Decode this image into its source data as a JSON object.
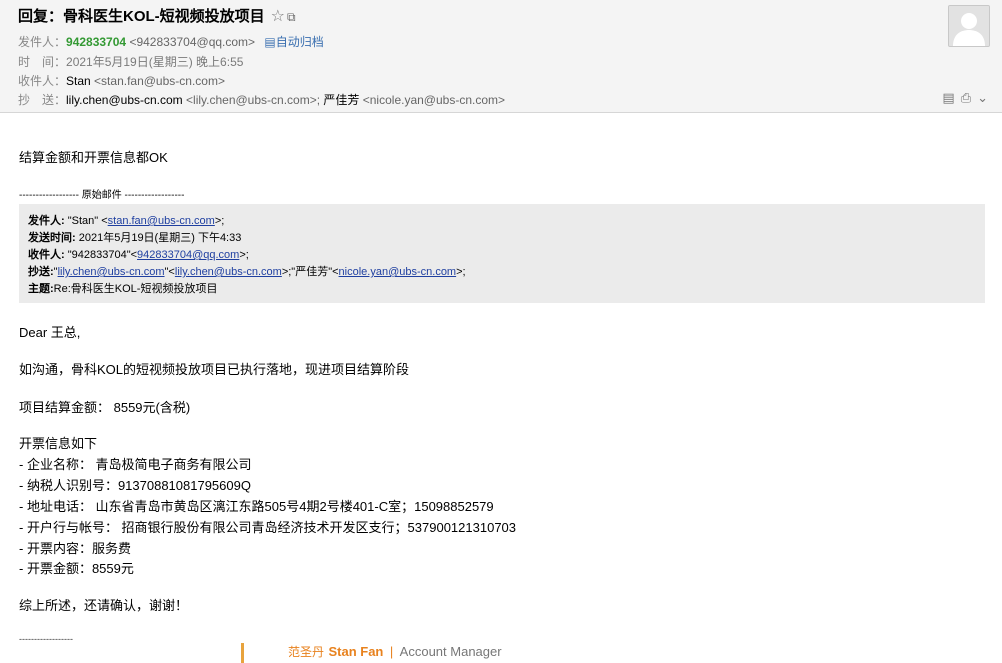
{
  "header": {
    "subject": "回复：骨科医生KOL-短视频投放项目",
    "star_glyph": "☆",
    "popout_glyph": "⧉",
    "from_label": "发件人：",
    "from_name": "942833704",
    "from_email": "<942833704@qq.com>",
    "auto_archive": "自动归档",
    "time_label": "时　间：",
    "time_value": "2021年5月19日(星期三) 晚上6:55",
    "to_label": "收件人：",
    "to_name": "Stan",
    "to_email": "<stan.fan@ubs-cn.com>",
    "cc_label": "抄　送：",
    "cc_name1": "lily.chen@ubs-cn.com",
    "cc_email1": "<lily.chen@ubs-cn.com>;",
    "cc_name2": "严佳芳",
    "cc_email2": "<nicole.yan@ubs-cn.com>"
  },
  "body": {
    "reply_line": "结算金额和开票信息都OK",
    "original_divider": "------------------ 原始邮件 ------------------",
    "quote": {
      "from_label": "发件人:",
      "from_value_pre": "\"Stan\" <",
      "from_link": "stan.fan@ubs-cn.com",
      "from_value_post": ">;",
      "sent_label": "发送时间:",
      "sent_value": "2021年5月19日(星期三) 下午4:33",
      "to_label": "收件人:",
      "to_value_pre": "\"942833704\"<",
      "to_link": "942833704@qq.com",
      "to_value_post": ">;",
      "cc_label": "抄送:",
      "cc_pre": "\"",
      "cc_link1": "lily.chen@ubs-cn.com",
      "cc_mid1": "\"<",
      "cc_link2": "lily.chen@ubs-cn.com",
      "cc_mid2": ">;\"严佳芳\"<",
      "cc_link3": "nicole.yan@ubs-cn.com",
      "cc_post": ">;",
      "subject_label": "主题:",
      "subject_value": "Re:骨科医生KOL-短视频投放项目"
    },
    "greeting": "Dear 王总,",
    "line1": "如沟通，骨科KOL的短视频投放项目已执行落地，现进项目结算阶段",
    "line2": "项目结算金额：  8559元(含税)",
    "invoice_title": "开票信息如下",
    "invoice_items": [
      "- 企业名称：  青岛极简电子商务有限公司",
      "- 纳税人识别号：91370881081795609Q",
      "- 地址电话：  山东省青岛市黄岛区漓江东路505号4期2号楼401-C室；15098852579",
      "- 开户行与帐号：  招商银行股份有限公司青岛经济技术开发区支行；537900121310703",
      "- 开票内容：服务费",
      "- 开票金额：8559元"
    ],
    "closing": "综上所述，还请确认，谢谢！",
    "sig_dash": "------------------",
    "signature": {
      "cn_name": "范圣丹",
      "en_name": "Stan Fan",
      "separator": "|",
      "role": "Account Manager"
    }
  },
  "colors": {
    "sender_green": "#339933",
    "link_blue": "#1f3fa0",
    "signature_orange": "#e8821e"
  }
}
